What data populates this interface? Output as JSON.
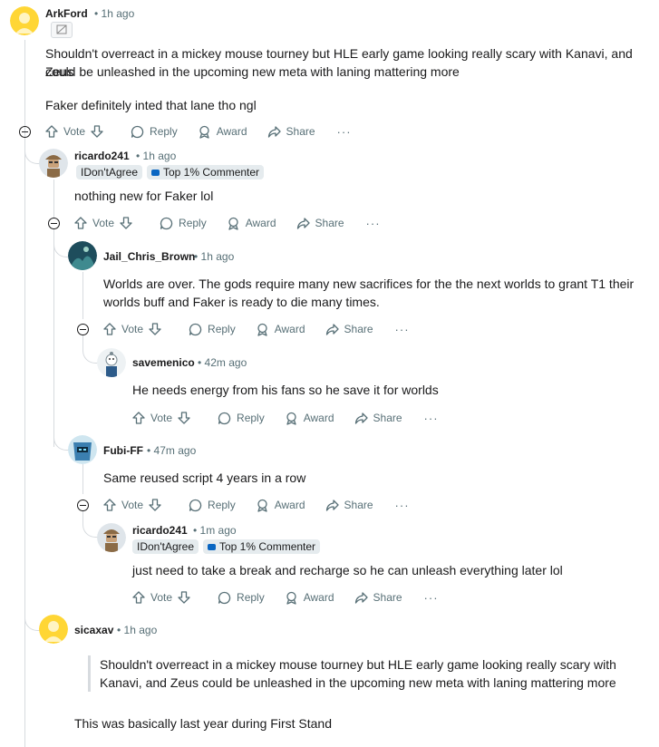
{
  "comments": {
    "c1": {
      "author": "ArkFord",
      "time": "1h ago",
      "body1": "Shouldn't overreact in a mickey mouse tourney but HLE early game looking really scary with Kanavi, and Zeus",
      "body2": "could be unleashed in the upcoming new meta with laning mattering more",
      "body3": "Faker definitely inted that lane tho ngl"
    },
    "c2": {
      "author": "ricardo241",
      "time": "1h ago",
      "flair1": "IDon'tAgree",
      "flair2": "Top 1% Commenter",
      "body1": "nothing new for Faker lol"
    },
    "c3": {
      "author": "Jail_Chris_Brown",
      "time": "1h ago",
      "body1": "Worlds are over. The gods require many new sacrifices for the the next worlds to grant T1 their",
      "body2": "worlds buff and Faker is ready to die many times."
    },
    "c4": {
      "author": "savemenico",
      "time": "42m ago",
      "body1": "He needs energy from his fans so he save it for worlds"
    },
    "c5": {
      "author": "Fubi-FF",
      "time": "47m ago",
      "body1": "Same reused script 4 years in a row"
    },
    "c6": {
      "author": "ricardo241",
      "time": "1m ago",
      "flair1": "IDon'tAgree",
      "flair2": "Top 1% Commenter",
      "body1": "just need to take a break and recharge so he can unleash everything later lol"
    },
    "c7": {
      "author": "sicaxav",
      "time": "1h ago",
      "quote1": "Shouldn't overreact in a mickey mouse tourney but HLE early game looking really scary with",
      "quote2": "Kanavi, and Zeus could be unleashed in the upcoming new meta with laning mattering more",
      "body1": "This was basically last year during First Stand"
    }
  },
  "actions": {
    "vote": "Vote",
    "reply": "Reply",
    "award": "Award",
    "share": "Share",
    "more": "···"
  },
  "separator": "•",
  "icons": {
    "upvote": "upvote-arrow-icon",
    "downvote": "downvote-arrow-icon",
    "reply": "reply-bubble-icon",
    "award": "award-icon",
    "share": "share-arrow-icon",
    "collapse": "collapse-thread-icon",
    "image": "image-embed-icon"
  },
  "colors": {
    "meta": "#576f76",
    "thread_line": "#d7dbdf",
    "flair_bg": "#e5ebee",
    "text": "#1a1a1b"
  }
}
